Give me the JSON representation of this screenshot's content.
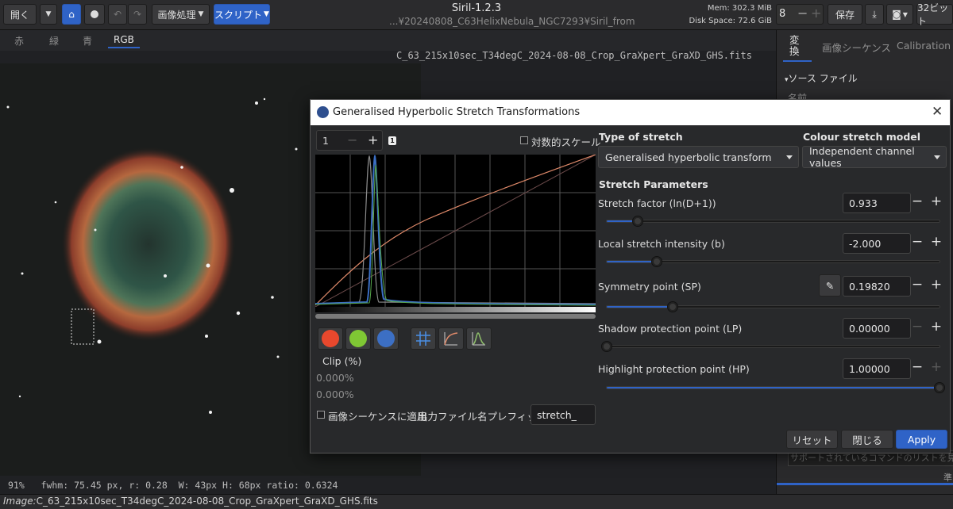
{
  "header": {
    "open": "開く",
    "image_processing": "画像処理",
    "scripts": "スクリプト",
    "title": "Siril-1.2.3",
    "path": "...¥20240808_C63HelixNebula_NGC7293¥Siril_from",
    "mem": "Mem: 302.3 MiB",
    "disk": "Disk Space: 72.6 GiB",
    "threads": "8",
    "save": "保存",
    "bits": "32ビット"
  },
  "channel_tabs": [
    "赤",
    "緑",
    "青",
    "RGB"
  ],
  "image_filename": "C_63_215x10sec_T34degC_2024-08-08_Crop_GraXpert_GraXD_GHS.fits",
  "status_line": "91%   fwhm: 75.45 px, r: 0.28  W: 43px H: 68px ratio: 0.6324",
  "bottom_image_label": "Image:",
  "bottom_image_name": "C_63_215x10sec_T34degC_2024-08-08_Crop_GraXpert_GraXD_GHS.fits",
  "right_panel": {
    "tabs": [
      "変換",
      "画像シーケンス",
      "Calibration"
    ],
    "section": "ソース ファイル",
    "name_col": "名前",
    "hint": "サポートされているコマンドのリストを見るに",
    "footer": "準"
  },
  "dialog": {
    "title": "Generalised Hyperbolic Stretch Transformations",
    "zoom_value": "1",
    "badge": "1",
    "log_scale": "対数的スケール",
    "type_label": "Type of stretch",
    "type_value": "Generalised hyperbolic transform",
    "colour_label": "Colour stretch model",
    "colour_value": "Independent channel values",
    "params_label": "Stretch Parameters",
    "params": [
      {
        "label": "Stretch factor (ln(D+1))",
        "value": "0.933",
        "level": 0.093
      },
      {
        "label": "Local stretch intensity (b)",
        "value": "-2.000",
        "level": 0.15
      },
      {
        "label": "Symmetry point (SP)",
        "value": "0.19820",
        "level": 0.198
      },
      {
        "label": "Shadow protection point (LP)",
        "value": "0.00000",
        "level": 0.0
      },
      {
        "label": "Highlight protection point (HP)",
        "value": "1.00000",
        "level": 1.0
      }
    ],
    "clip_label": "Clip (%)",
    "clip_low": "0.000%",
    "clip_high": "0.000%",
    "apply_seq": "画像シーケンスに適用",
    "prefix_label": "出力ファイル名プレフィックス:",
    "prefix_value": "stretch_",
    "reset": "リセット",
    "close": "閉じる",
    "apply": "Apply",
    "colors": {
      "red": "#e8482d",
      "green": "#7fc734",
      "blue": "#3c6fc4",
      "accent": "#2f63c7"
    }
  }
}
